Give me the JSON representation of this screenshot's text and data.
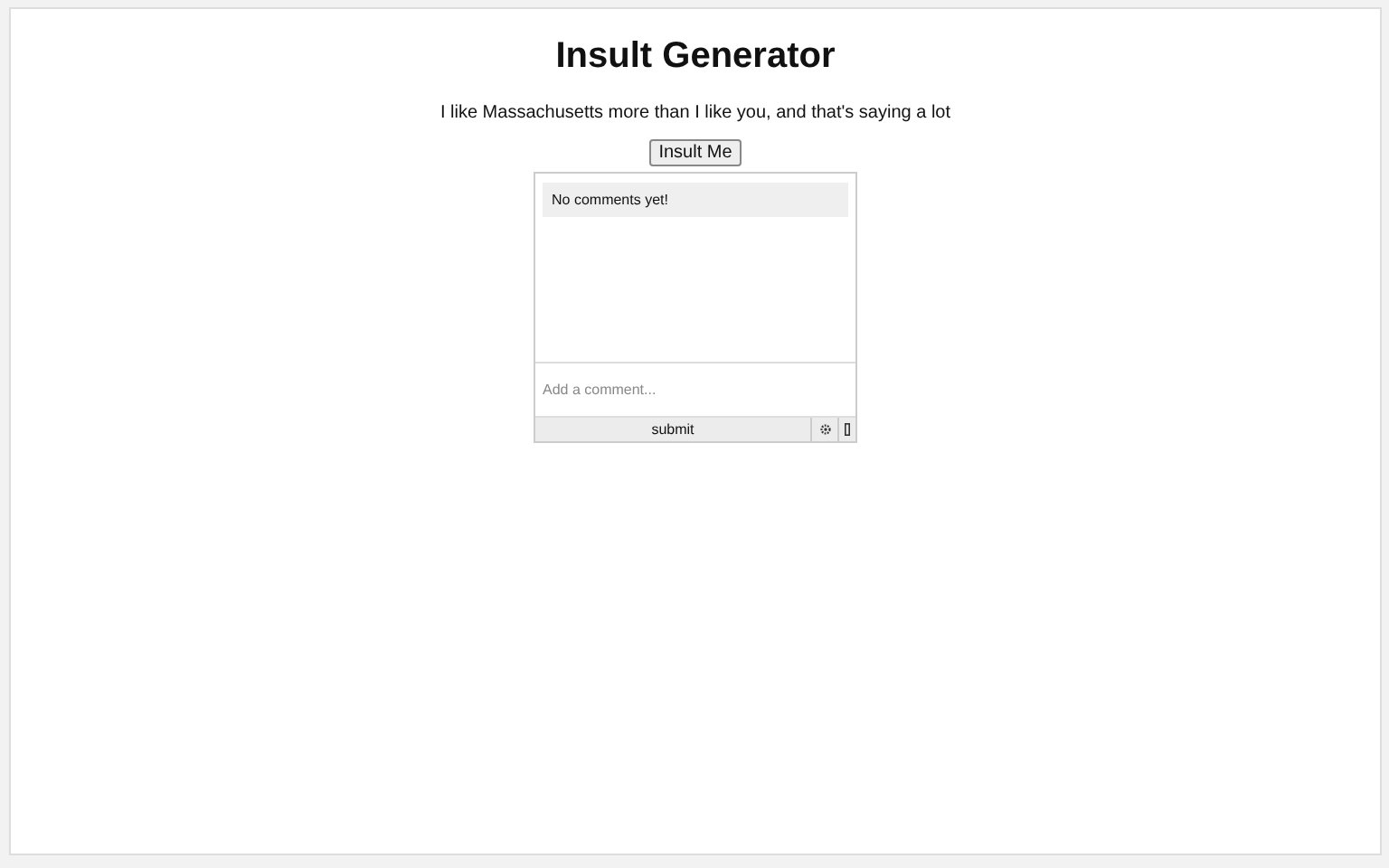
{
  "title": "Insult Generator",
  "insult": "I like Massachusetts more than I like you, and that's saying a lot",
  "button": "Insult Me",
  "comments": {
    "empty_message": "No comments yet!",
    "placeholder": "Add a comment...",
    "submit": "submit"
  }
}
